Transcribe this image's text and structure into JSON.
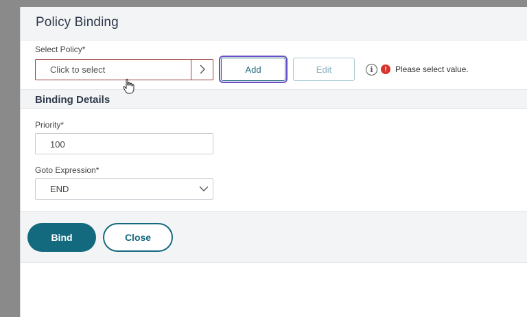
{
  "dialog": {
    "title": "Policy Binding"
  },
  "select_policy": {
    "label": "Select Policy*",
    "placeholder": "Click to select",
    "add_label": "Add",
    "edit_label": "Edit",
    "error_message": "Please select value.",
    "error_color": "#d9342b"
  },
  "binding_details": {
    "title": "Binding Details",
    "priority_label": "Priority*",
    "priority_value": "100",
    "goto_label": "Goto Expression*",
    "goto_value": "END"
  },
  "footer": {
    "bind_label": "Bind",
    "close_label": "Close",
    "accent_color": "#13697d"
  }
}
